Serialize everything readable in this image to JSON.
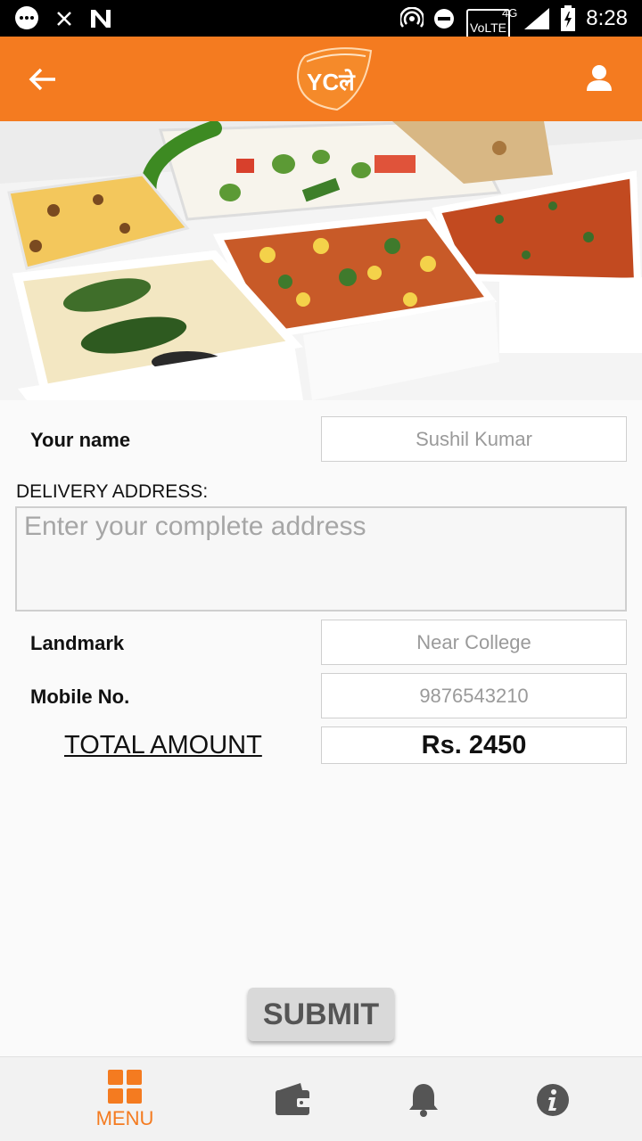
{
  "status_bar": {
    "time": "8:28",
    "network_volte": "VoLTE",
    "network_type": "4G",
    "icons": [
      "messenger-icon",
      "close-icon",
      "n-icon",
      "hotspot-icon",
      "dnd-icon",
      "signal-icon",
      "battery-charging-icon"
    ]
  },
  "app_bar": {
    "back_icon": "arrow-left-icon",
    "logo_text": "YCले",
    "profile_icon": "person-icon",
    "accent_color": "#f47b20"
  },
  "hero": {
    "image": "food-thali-tray"
  },
  "form": {
    "name_label": "Your name",
    "name_value": "Sushil Kumar",
    "address_label": "DELIVERY ADDRESS:",
    "address_placeholder": "Enter your complete address",
    "landmark_label": "Landmark",
    "landmark_value": "Near College",
    "mobile_label": "Mobile No.",
    "mobile_value": "9876543210",
    "total_label": "TOTAL AMOUNT",
    "total_value": "Rs. 2450"
  },
  "submit_label": "SUBMIT",
  "bottom_nav": {
    "items": [
      {
        "label": "MENU",
        "icon": "grid-icon",
        "active": true
      },
      {
        "label": "",
        "icon": "wallet-icon",
        "active": false
      },
      {
        "label": "",
        "icon": "bell-icon",
        "active": false
      },
      {
        "label": "",
        "icon": "info-icon",
        "active": false
      }
    ]
  }
}
